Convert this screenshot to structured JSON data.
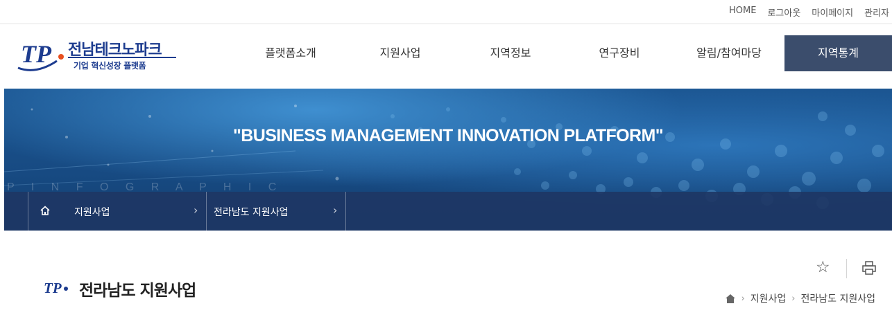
{
  "util_links": [
    "HOME",
    "로그아웃",
    "마이페이지",
    "관리자"
  ],
  "logo": {
    "title": "전남테크노파크",
    "subtitle": "기업 혁신성장 플랫폼",
    "mark_text": "TP"
  },
  "nav": [
    {
      "label": "플랫폼소개",
      "active": false
    },
    {
      "label": "지원사업",
      "active": false
    },
    {
      "label": "지역정보",
      "active": false
    },
    {
      "label": "연구장비",
      "active": false
    },
    {
      "label": "알림/참여마당",
      "active": false
    },
    {
      "label": "지역통계",
      "active": true
    }
  ],
  "banner": {
    "headline": "\"BUSINESS MANAGEMENT INNOVATION PLATFORM\"",
    "faint_text": "P I N F O G R A P H I C"
  },
  "location": {
    "level1": "지원사업",
    "level2": "전라남도 지원사업",
    "arrow": "›"
  },
  "page": {
    "title": "전라남도 지원사업"
  },
  "breadcrumb": [
    "지원사업",
    "전라남도 지원사업"
  ],
  "colors": {
    "brand": "#1d3c8f",
    "nav_active": "#3b4d6c",
    "location_bar": "#1e3664"
  },
  "icons": {
    "star": "☆",
    "print": "printer-icon",
    "home": "home-icon"
  }
}
